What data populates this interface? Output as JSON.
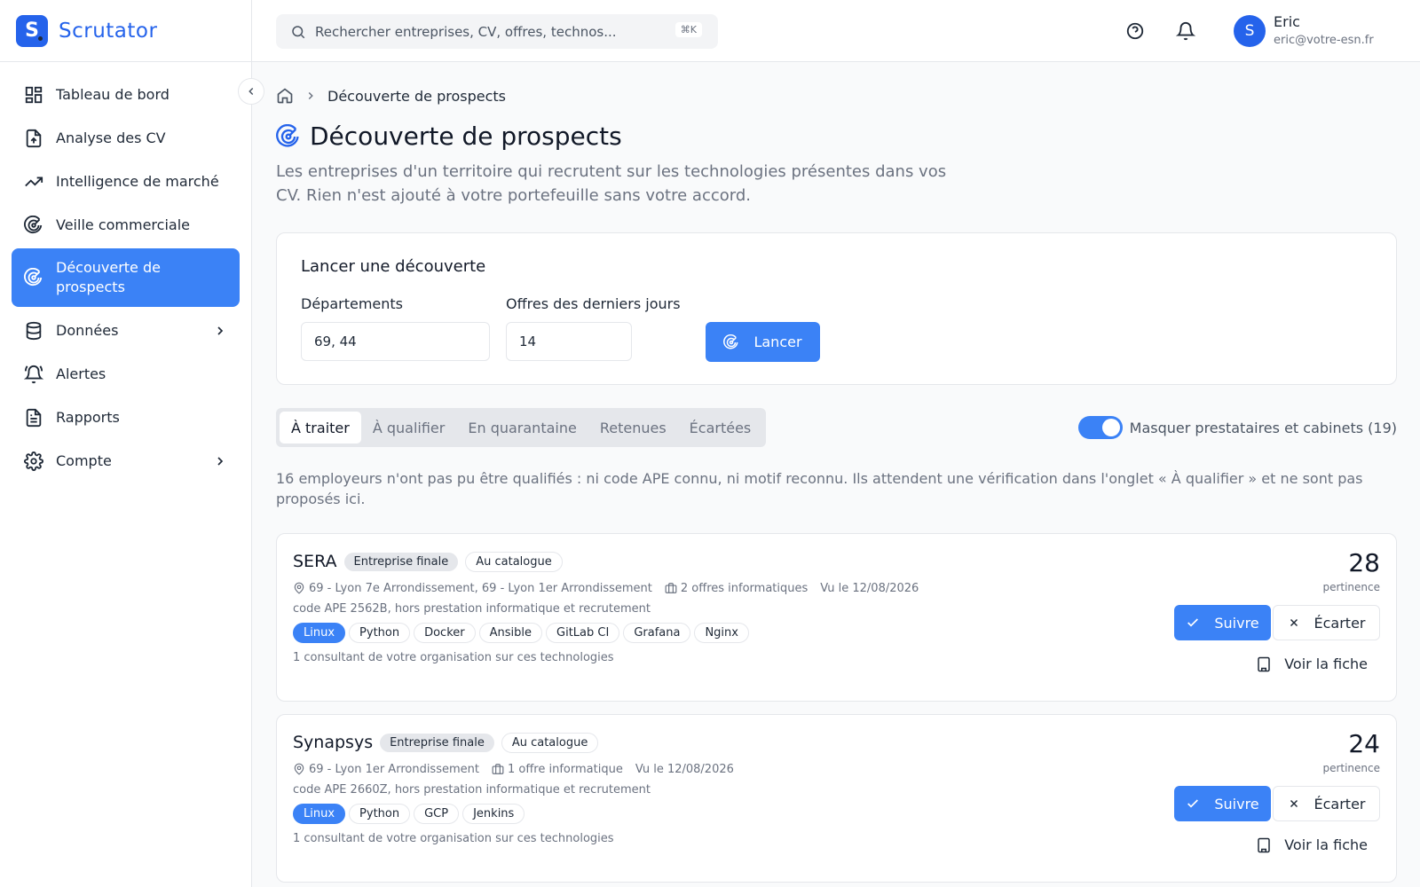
{
  "app": {
    "logo_letter": "S",
    "name": "Scrutator",
    "brand_color": "#2563eb",
    "accent_color": "#3b82f6"
  },
  "sidebar": {
    "items": [
      {
        "label": "Tableau de bord",
        "icon": "dashboard-icon"
      },
      {
        "label": "Analyse des CV",
        "icon": "file-upload-icon"
      },
      {
        "label": "Intelligence de marché",
        "icon": "trending-up-icon"
      },
      {
        "label": "Veille commerciale",
        "icon": "radar-icon"
      },
      {
        "label": "Découverte de prospects",
        "icon": "radar-icon",
        "active": true
      },
      {
        "label": "Données",
        "icon": "database-icon",
        "expandable": true
      },
      {
        "label": "Alertes",
        "icon": "bell-ring-icon"
      },
      {
        "label": "Rapports",
        "icon": "report-icon"
      },
      {
        "label": "Compte",
        "icon": "gear-icon",
        "expandable": true
      }
    ]
  },
  "header": {
    "search_placeholder": "Rechercher entreprises, CV, offres, technos...",
    "search_shortcut": "⌘K",
    "user": {
      "initial": "S",
      "name": "Eric",
      "email": "eric@votre-esn.fr"
    }
  },
  "breadcrumb": {
    "current": "Découverte de prospects"
  },
  "page": {
    "title": "Découverte de prospects",
    "description": "Les entreprises d'un territoire qui recrutent sur les technologies présentes dans vos CV. Rien n'est ajouté à votre portefeuille sans votre accord."
  },
  "launch": {
    "title": "Lancer une découverte",
    "departments_label": "Départements",
    "departments_value": "69, 44",
    "days_label": "Offres des derniers jours",
    "days_value": "14",
    "button_label": "Lancer"
  },
  "tabs": [
    "À traiter",
    "À qualifier",
    "En quarantaine",
    "Retenues",
    "Écartées"
  ],
  "active_tab": "À traiter",
  "toggle": {
    "label": "Masquer prestataires et cabinets (19)",
    "on": true
  },
  "notice": "16 employeurs n'ont pas pu être qualifiés : ni code APE connu, ni motif reconnu. Ils attendent une vérification dans l'onglet « À qualifier » et ne sont pas proposés ici.",
  "prospects": [
    {
      "name": "SERA",
      "badges": [
        "Entreprise finale",
        "Au catalogue"
      ],
      "location": "69 - Lyon 7e Arrondissement, 69 - Lyon 1er Arrondissement",
      "offers": "2 offres informatiques",
      "seen": "Vu le 12/08/2026",
      "ape": "code APE 2562B, hors prestation informatique et recrutement",
      "tags": [
        "Linux",
        "Python",
        "Docker",
        "Ansible",
        "GitLab CI",
        "Grafana",
        "Nginx"
      ],
      "consultants": "1 consultant de votre organisation sur ces technologies",
      "score": "28",
      "score_label": "pertinence",
      "follow_label": "Suivre",
      "discard_label": "Écarter",
      "view_label": "Voir la fiche"
    },
    {
      "name": "Synapsys",
      "badges": [
        "Entreprise finale",
        "Au catalogue"
      ],
      "location": "69 - Lyon 1er Arrondissement",
      "offers": "1 offre informatique",
      "seen": "Vu le 12/08/2026",
      "ape": "code APE 2660Z, hors prestation informatique et recrutement",
      "tags": [
        "Linux",
        "Python",
        "GCP",
        "Jenkins"
      ],
      "consultants": "1 consultant de votre organisation sur ces technologies",
      "score": "24",
      "score_label": "pertinence",
      "follow_label": "Suivre",
      "discard_label": "Écarter",
      "view_label": "Voir la fiche"
    }
  ]
}
